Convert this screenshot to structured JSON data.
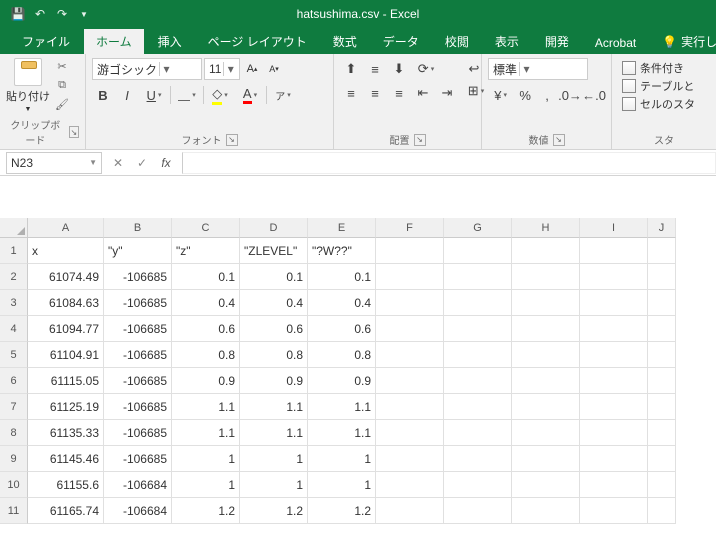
{
  "titlebar": {
    "document": "hatsushima.csv - Excel"
  },
  "tabs": {
    "file": "ファイル",
    "home": "ホーム",
    "insert": "挿入",
    "pagelayout": "ページ レイアウト",
    "formulas": "数式",
    "data": "データ",
    "review": "校閲",
    "view": "表示",
    "developer": "開発",
    "acrobat": "Acrobat",
    "tellme": "実行したい作"
  },
  "ribbon": {
    "clipboard": {
      "paste": "貼り付け",
      "label": "クリップボード"
    },
    "font": {
      "family": "游ゴシック",
      "size": "11",
      "label": "フォント",
      "bold": "B",
      "italic": "I",
      "underline": "U",
      "a_large": "A",
      "a_small": "A",
      "ruby": "ア",
      "font_color": "A"
    },
    "alignment": {
      "label": "配置"
    },
    "number": {
      "format": "標準",
      "label": "数値",
      "percent": "%",
      "comma": ",",
      "dec_inc": "",
      "dec_dec": ""
    },
    "styles": {
      "cond": "条件付き",
      "table": "テーブルと",
      "cell": "セルのスタ",
      "label": "スタ"
    }
  },
  "formulabar": {
    "namebox": "N23",
    "value": ""
  },
  "sheet": {
    "columns": [
      "A",
      "B",
      "C",
      "D",
      "E",
      "F",
      "G",
      "H",
      "I",
      "J"
    ],
    "row_numbers": [
      "1",
      "2",
      "3",
      "4",
      "5",
      "6",
      "7",
      "8",
      "9",
      "10",
      "11"
    ],
    "header_row": [
      "x",
      "\"y\"",
      "\"z\"",
      "\"ZLEVEL\"",
      "\"?W??\""
    ],
    "rows": [
      {
        "A": "61074.49",
        "B": "-106685",
        "C": "0.1",
        "D": "0.1",
        "E": "0.1"
      },
      {
        "A": "61084.63",
        "B": "-106685",
        "C": "0.4",
        "D": "0.4",
        "E": "0.4"
      },
      {
        "A": "61094.77",
        "B": "-106685",
        "C": "0.6",
        "D": "0.6",
        "E": "0.6"
      },
      {
        "A": "61104.91",
        "B": "-106685",
        "C": "0.8",
        "D": "0.8",
        "E": "0.8"
      },
      {
        "A": "61115.05",
        "B": "-106685",
        "C": "0.9",
        "D": "0.9",
        "E": "0.9"
      },
      {
        "A": "61125.19",
        "B": "-106685",
        "C": "1.1",
        "D": "1.1",
        "E": "1.1"
      },
      {
        "A": "61135.33",
        "B": "-106685",
        "C": "1.1",
        "D": "1.1",
        "E": "1.1"
      },
      {
        "A": "61145.46",
        "B": "-106685",
        "C": "1",
        "D": "1",
        "E": "1"
      },
      {
        "A": "61155.6",
        "B": "-106684",
        "C": "1",
        "D": "1",
        "E": "1"
      },
      {
        "A": "61165.74",
        "B": "-106684",
        "C": "1.2",
        "D": "1.2",
        "E": "1.2"
      }
    ]
  }
}
